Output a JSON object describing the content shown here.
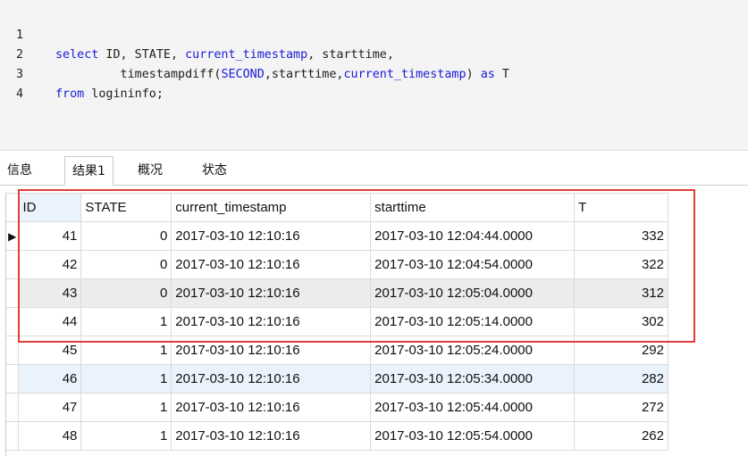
{
  "editor": {
    "lines": [
      {
        "no": "1",
        "tokens": [
          {
            "t": "select",
            "k": "kw"
          },
          {
            "t": " ID, STATE, ",
            "k": "tx"
          },
          {
            "t": "current_timestamp",
            "k": "kw"
          },
          {
            "t": ", starttime,",
            "k": "tx"
          }
        ]
      },
      {
        "no": "2",
        "tokens": [
          {
            "t": "         timestampdiff(",
            "k": "tx"
          },
          {
            "t": "SECOND",
            "k": "kw"
          },
          {
            "t": ",starttime,",
            "k": "tx"
          },
          {
            "t": "current_timestamp",
            "k": "kw"
          },
          {
            "t": ") ",
            "k": "tx"
          },
          {
            "t": "as",
            "k": "kw"
          },
          {
            "t": " T",
            "k": "tx"
          }
        ]
      },
      {
        "no": "3",
        "tokens": [
          {
            "t": "from",
            "k": "kw"
          },
          {
            "t": " logininfo;",
            "k": "tx"
          }
        ]
      },
      {
        "no": "4",
        "tokens": []
      }
    ]
  },
  "tabs": [
    {
      "label": "信息",
      "active": false
    },
    {
      "label": "结果1",
      "active": true
    },
    {
      "label": "概况",
      "active": false
    },
    {
      "label": "状态",
      "active": false
    }
  ],
  "grid": {
    "columns": [
      "ID",
      "STATE",
      "current_timestamp",
      "starttime",
      "T"
    ],
    "current_row_marker": "▶",
    "rows": [
      [
        "41",
        "0",
        "2017-03-10 12:10:16",
        "2017-03-10 12:04:44.0000",
        "332"
      ],
      [
        "42",
        "0",
        "2017-03-10 12:10:16",
        "2017-03-10 12:04:54.0000",
        "322"
      ],
      [
        "43",
        "0",
        "2017-03-10 12:10:16",
        "2017-03-10 12:05:04.0000",
        "312"
      ],
      [
        "44",
        "1",
        "2017-03-10 12:10:16",
        "2017-03-10 12:05:14.0000",
        "302"
      ],
      [
        "45",
        "1",
        "2017-03-10 12:10:16",
        "2017-03-10 12:05:24.0000",
        "292"
      ],
      [
        "46",
        "1",
        "2017-03-10 12:10:16",
        "2017-03-10 12:05:34.0000",
        "282"
      ],
      [
        "47",
        "1",
        "2017-03-10 12:10:16",
        "2017-03-10 12:05:44.0000",
        "272"
      ],
      [
        "48",
        "1",
        "2017-03-10 12:10:16",
        "2017-03-10 12:05:54.0000",
        "262"
      ]
    ],
    "row_tints": [
      "white",
      "white",
      "gray",
      "white",
      "white",
      "blue",
      "white",
      "white"
    ]
  },
  "colors": {
    "keyword": "#1a1ad6",
    "highlight_border": "#e33c3c",
    "row_gray": "#ececec",
    "row_blue": "#eaf3fc"
  }
}
